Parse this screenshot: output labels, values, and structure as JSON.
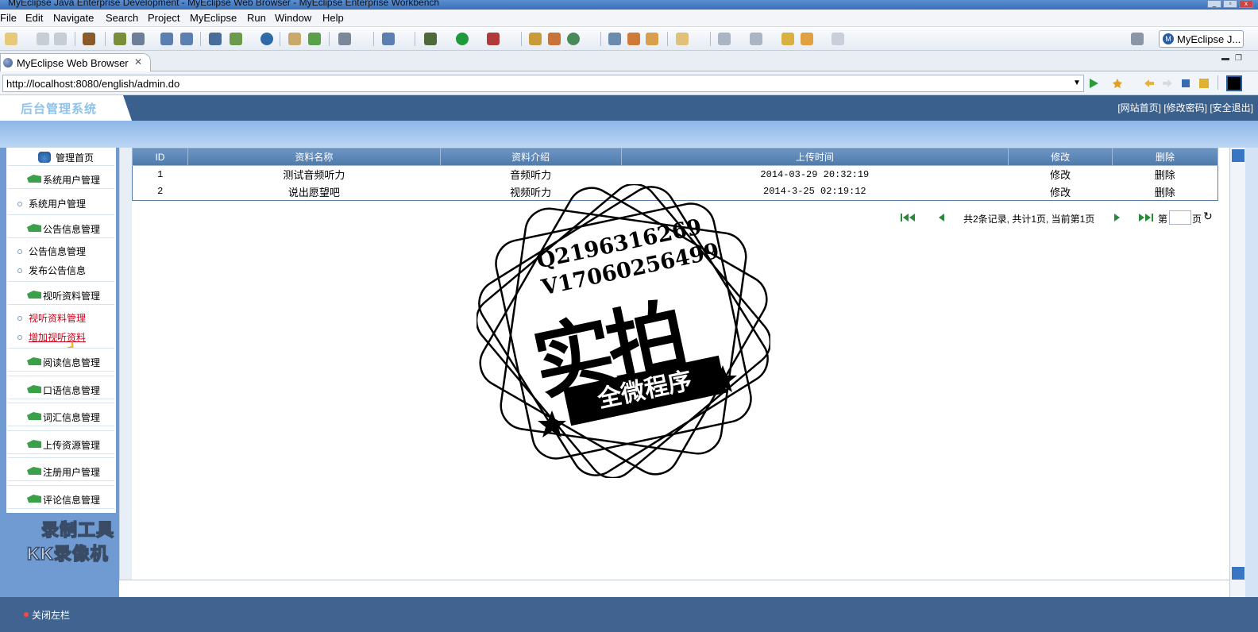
{
  "window": {
    "title": "MyEclipse Java Enterprise Development - MyEclipse Web Browser - MyEclipse Enterprise Workbench"
  },
  "menu": [
    "File",
    "Edit",
    "Navigate",
    "Search",
    "Project",
    "MyEclipse",
    "Run",
    "Window",
    "Help"
  ],
  "perspective": {
    "label": "MyEclipse J...",
    "icon": "myeclipse-icon"
  },
  "editor_tab": {
    "label": "MyEclipse Web Browser",
    "icon": "globe-icon"
  },
  "address": {
    "url": "http://localhost:8080/english/admin.do"
  },
  "banner": {
    "logo": "后台管理系统",
    "links": "[网站首页] [修改密码] [安全退出]"
  },
  "sidebar": {
    "home": "管理首页",
    "groups": [
      {
        "label": "系统用户管理"
      },
      {
        "label": "公告信息管理"
      },
      {
        "label": "视听资料管理"
      },
      {
        "label": "阅读信息管理"
      },
      {
        "label": "口语信息管理"
      },
      {
        "label": "词汇信息管理"
      },
      {
        "label": "上传资源管理"
      },
      {
        "label": "注册用户管理"
      },
      {
        "label": "评论信息管理"
      }
    ],
    "subs": [
      {
        "label": "系统用户管理"
      },
      {
        "label": "公告信息管理"
      },
      {
        "label": "发布公告信息"
      },
      {
        "label": "视听资料管理"
      },
      {
        "label": "增加视听资料"
      }
    ]
  },
  "table": {
    "headers": [
      "ID",
      "资料名称",
      "资料介绍",
      "上传时间",
      "修改",
      "删除"
    ],
    "rows": [
      {
        "id": "1",
        "name": "测试音频听力",
        "intro": "音频听力",
        "time": "2014-03-29 20:32:19",
        "edit": "修改",
        "del": "删除"
      },
      {
        "id": "2",
        "name": "说出愿望吧",
        "intro": "视频听力",
        "time": "2014-3-25 02:19:12",
        "edit": "修改",
        "del": "删除"
      }
    ]
  },
  "pager": {
    "summary": "共2条记录, 共计1页, 当前第1页",
    "page_prefix": "第",
    "page_suffix": "页",
    "page_value": ""
  },
  "watermark": {
    "tool_line1": "录制工具",
    "tool_line2": "KK录像机",
    "stamp_qq": "Q2196316269",
    "stamp_v": "V17060256499",
    "stamp_big": "实拍",
    "stamp_ribbon": "全微程序"
  },
  "footer": {
    "close_sidebar": "关闭左栏"
  },
  "colors": {
    "banner": "#3a618e",
    "sidebar": "#6f9bd2",
    "header": "#5a83b3",
    "link_red": "#d0001a"
  }
}
